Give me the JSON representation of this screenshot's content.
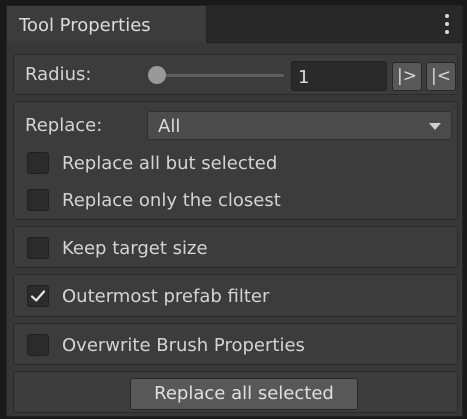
{
  "window": {
    "tab_title": "Tool Properties",
    "menu_icon": "kebab-menu-icon"
  },
  "radius": {
    "label": "Radius:",
    "value": "1",
    "increase_label": "|>",
    "decrease_label": "|<",
    "slider_position": 0
  },
  "replace": {
    "label": "Replace:",
    "selected": "All",
    "options": [
      {
        "label": "Replace all but selected",
        "checked": false
      },
      {
        "label": "Replace only the closest",
        "checked": false
      }
    ]
  },
  "keep_target_size": {
    "label": "Keep target size",
    "checked": false
  },
  "outermost_prefab_filter": {
    "label": "Outermost prefab filter",
    "checked": true
  },
  "overwrite_brush_properties": {
    "label": "Overwrite Brush Properties",
    "checked": false
  },
  "action": {
    "button_label": "Replace all selected"
  },
  "colors": {
    "panel": "#383838",
    "group": "#3c3c3c",
    "field": "#2a2a2a",
    "button": "#585858",
    "text": "#d2d2d2"
  }
}
